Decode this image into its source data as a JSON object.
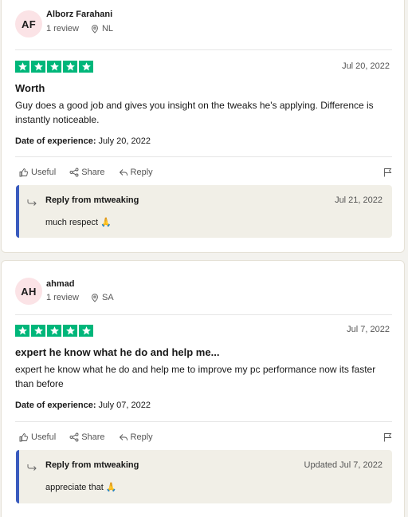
{
  "reviews": [
    {
      "initials": "AF",
      "name": "Alborz Farahani",
      "review_count": "1 review",
      "country": "NL",
      "stars": 5,
      "date": "Jul 20, 2022",
      "title": "Worth",
      "body": "Guy does a good job and gives you insight on the tweaks he's applying. Difference is instantly noticeable.",
      "experience_label": "Date of experience:",
      "experience_date": "July 20, 2022",
      "actions": {
        "useful": "Useful",
        "share": "Share",
        "reply": "Reply"
      },
      "reply": {
        "from": "Reply from mtweaking",
        "date": "Jul 21, 2022",
        "text": "much respect",
        "emoji_icon": "folded-hands-icon"
      }
    },
    {
      "initials": "AH",
      "name": "ahmad",
      "review_count": "1 review",
      "country": "SA",
      "stars": 5,
      "date": "Jul 7, 2022",
      "title": "expert he know what he do and help me...",
      "body": "expert he know what he do and help me to improve my pc performance now its faster than before",
      "experience_label": "Date of experience:",
      "experience_date": "July 07, 2022",
      "actions": {
        "useful": "Useful",
        "share": "Share",
        "reply": "Reply"
      },
      "reply": {
        "from": "Reply from mtweaking",
        "date": "Updated Jul 7, 2022",
        "text": "appreciate that",
        "emoji_icon": "folded-hands-icon"
      }
    }
  ],
  "colors": {
    "star_green": "#00b67a",
    "reply_accent": "#3a5bbe",
    "avatar_bg": "#fbe3e6",
    "reply_bg": "#f1efe7"
  }
}
